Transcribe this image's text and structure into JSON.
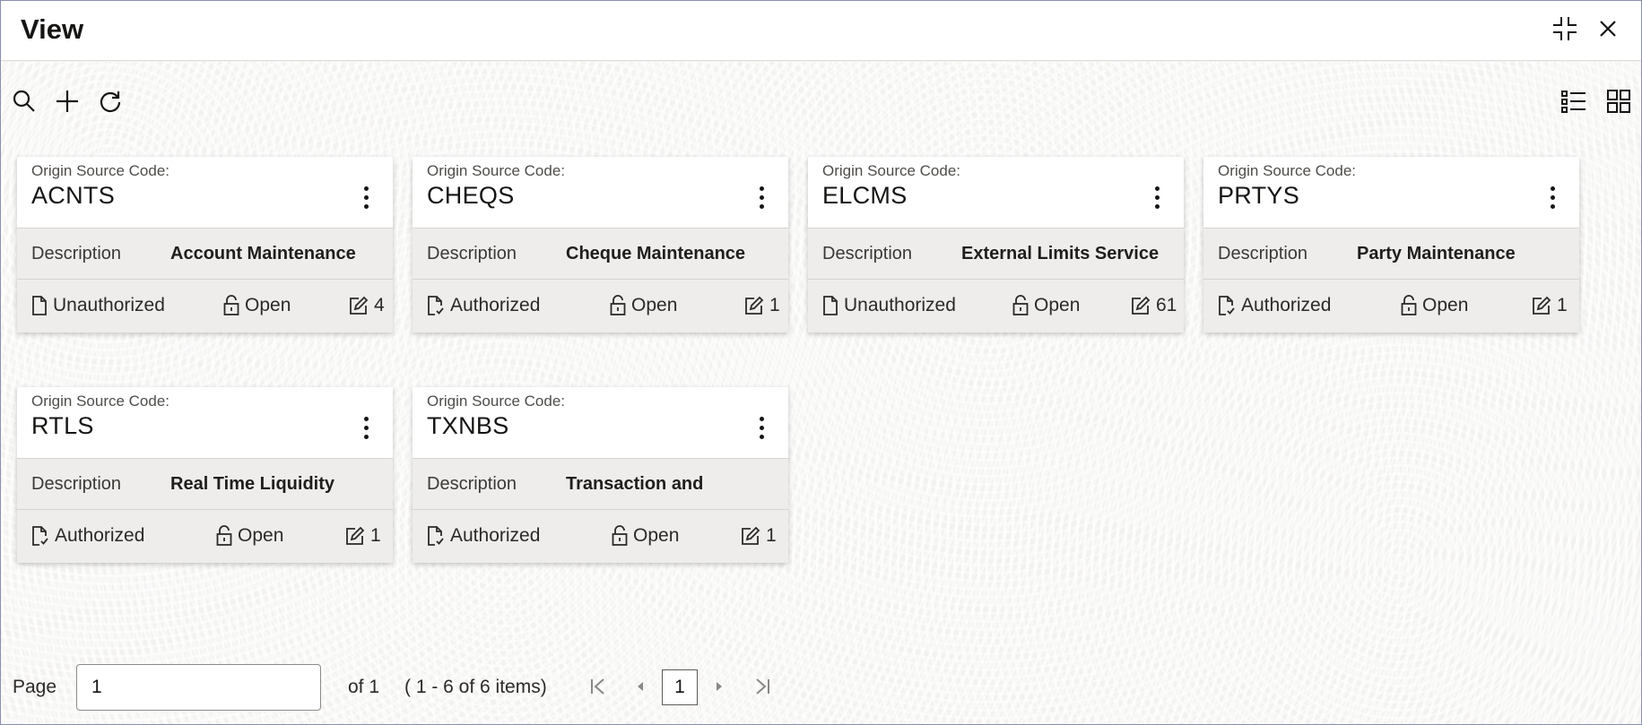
{
  "window": {
    "title": "View"
  },
  "toolbar": {
    "search": "search-icon",
    "add": "plus-icon",
    "refresh": "refresh-icon",
    "list_view": "list-view-icon",
    "grid_view": "grid-view-icon"
  },
  "cards": [
    {
      "label": "Origin Source Code:",
      "code": "ACNTS",
      "desc_label": "Description",
      "desc": "Account Maintenance",
      "status": "Unauthorized",
      "authorized": false,
      "lock": "Open",
      "mods": "4"
    },
    {
      "label": "Origin Source Code:",
      "code": "CHEQS",
      "desc_label": "Description",
      "desc": "Cheque Maintenance",
      "status": "Authorized",
      "authorized": true,
      "lock": "Open",
      "mods": "1"
    },
    {
      "label": "Origin Source Code:",
      "code": "ELCMS",
      "desc_label": "Description",
      "desc": "External Limits Service",
      "status": "Unauthorized",
      "authorized": false,
      "lock": "Open",
      "mods": "61"
    },
    {
      "label": "Origin Source Code:",
      "code": "PRTYS",
      "desc_label": "Description",
      "desc": "Party Maintenance",
      "status": "Authorized",
      "authorized": true,
      "lock": "Open",
      "mods": "1"
    },
    {
      "label": "Origin Source Code:",
      "code": "RTLS",
      "desc_label": "Description",
      "desc": "Real Time Liquidity",
      "status": "Authorized",
      "authorized": true,
      "lock": "Open",
      "mods": "1"
    },
    {
      "label": "Origin Source Code:",
      "code": "TXNBS",
      "desc_label": "Description",
      "desc": "Transaction and",
      "status": "Authorized",
      "authorized": true,
      "lock": "Open",
      "mods": "1"
    }
  ],
  "pagination": {
    "page_label": "Page",
    "page_value": "1",
    "of_text": "of 1",
    "items_text": "( 1 - 6 of 6 items)",
    "current_page": "1"
  }
}
